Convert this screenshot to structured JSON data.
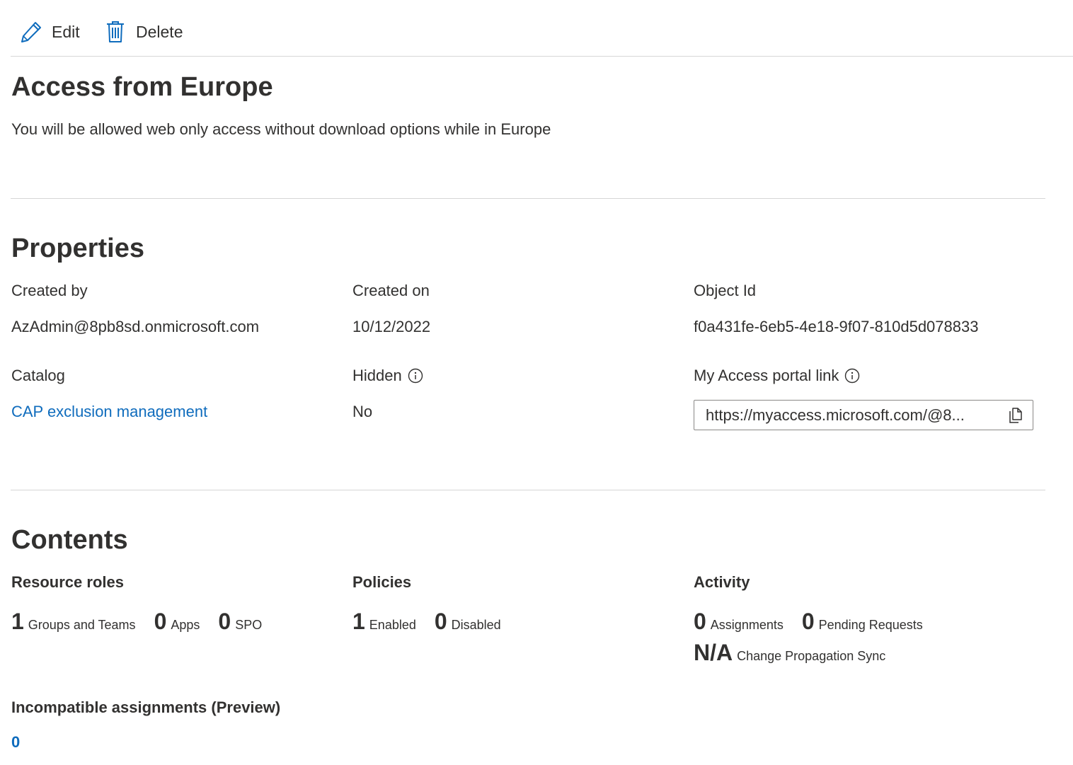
{
  "toolbar": {
    "edit_label": "Edit",
    "delete_label": "Delete"
  },
  "header": {
    "title": "Access from Europe",
    "description": "You will be allowed web only access without download options while in Europe"
  },
  "properties": {
    "section_title": "Properties",
    "created_by": {
      "label": "Created by",
      "value": "AzAdmin@8pb8sd.onmicrosoft.com"
    },
    "created_on": {
      "label": "Created on",
      "value": "10/12/2022"
    },
    "object_id": {
      "label": "Object Id",
      "value": "f0a431fe-6eb5-4e18-9f07-810d5d078833"
    },
    "catalog": {
      "label": "Catalog",
      "value": "CAP exclusion management"
    },
    "hidden": {
      "label": "Hidden",
      "value": "No"
    },
    "portal_link": {
      "label": "My Access portal link",
      "value": "https://myaccess.microsoft.com/@8..."
    }
  },
  "contents": {
    "section_title": "Contents",
    "resource_roles": {
      "title": "Resource roles",
      "groups_count": "1",
      "groups_label": "Groups and Teams",
      "apps_count": "0",
      "apps_label": "Apps",
      "spo_count": "0",
      "spo_label": "SPO"
    },
    "policies": {
      "title": "Policies",
      "enabled_count": "1",
      "enabled_label": "Enabled",
      "disabled_count": "0",
      "disabled_label": "Disabled"
    },
    "activity": {
      "title": "Activity",
      "assignments_count": "0",
      "assignments_label": "Assignments",
      "pending_count": "0",
      "pending_label": "Pending Requests",
      "sync_value": "N/A",
      "sync_label": "Change Propagation Sync"
    },
    "incompatible": {
      "title": "Incompatible assignments (Preview)",
      "count": "0"
    }
  },
  "colors": {
    "accent": "#0f6cbd",
    "text": "#323130",
    "divider": "#d6d6d6"
  }
}
